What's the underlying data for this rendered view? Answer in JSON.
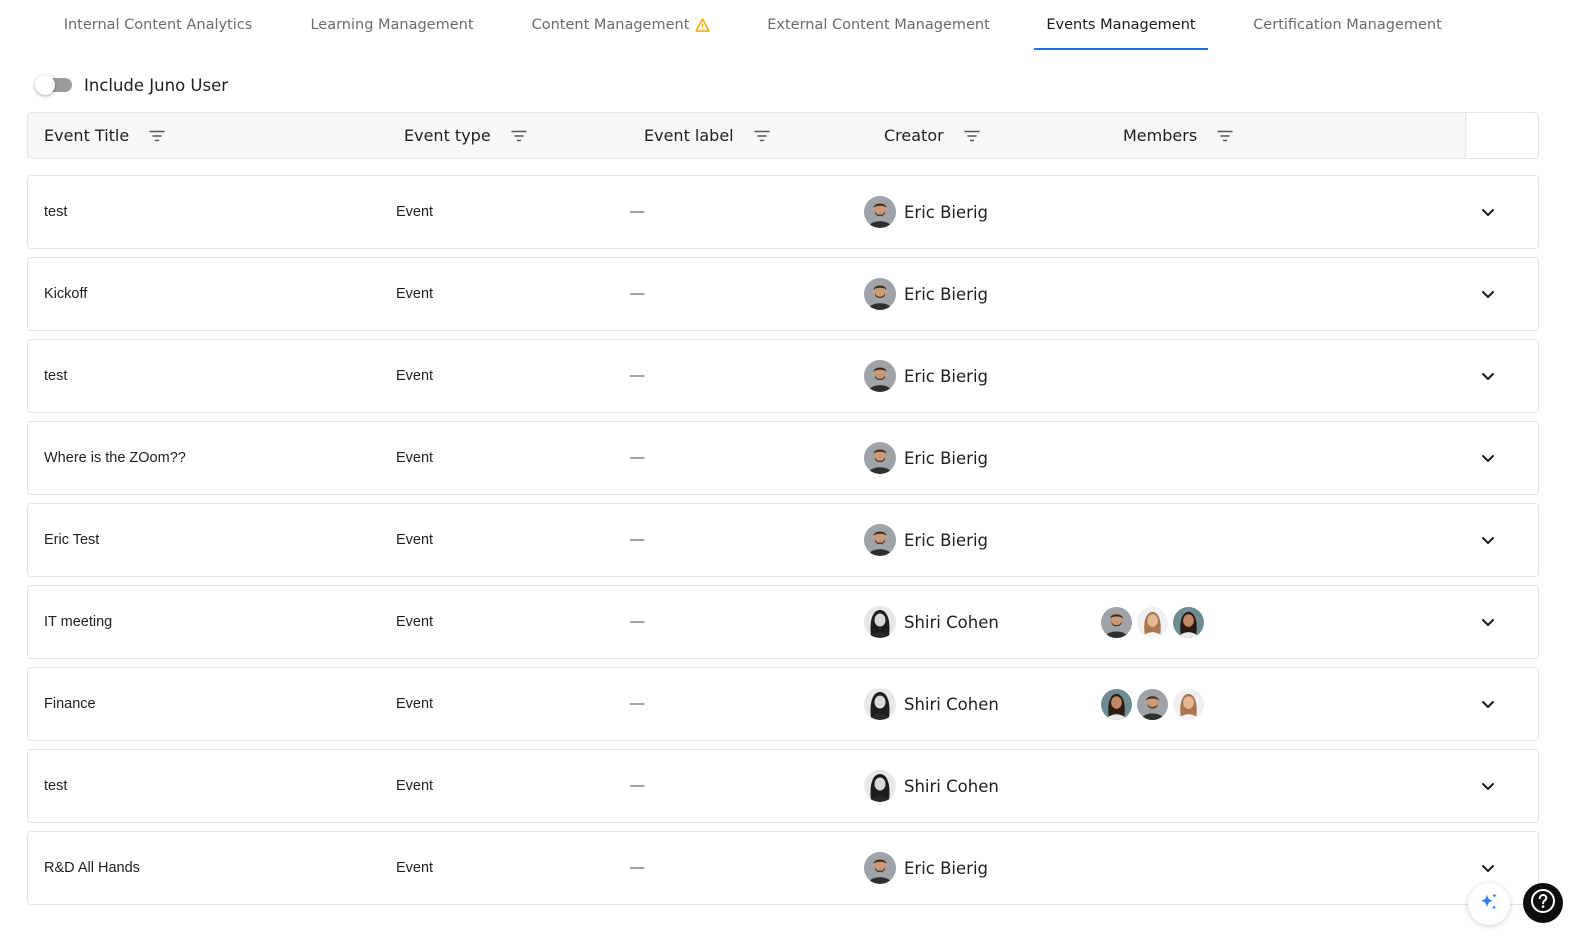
{
  "tabs": [
    {
      "label": "Internal Content Analytics"
    },
    {
      "label": "Learning Management"
    },
    {
      "label": "Content Management"
    },
    {
      "label": "External Content Management"
    },
    {
      "label": "Events Management"
    },
    {
      "label": "Certification Management"
    }
  ],
  "active_tab": "Events Management",
  "toggle": {
    "label": "Include Juno User",
    "checked": false
  },
  "columns": [
    {
      "label": "Event Title"
    },
    {
      "label": "Event type"
    },
    {
      "label": "Event label"
    },
    {
      "label": "Creator"
    },
    {
      "label": "Members"
    }
  ],
  "rows": [
    {
      "title": "test",
      "type": "Event",
      "label": "—",
      "creator": "Eric Bierig",
      "members": []
    },
    {
      "title": "Kickoff",
      "type": "Event",
      "label": "—",
      "creator": "Eric Bierig",
      "members": []
    },
    {
      "title": "test",
      "type": "Event",
      "label": "—",
      "creator": "Eric Bierig",
      "members": []
    },
    {
      "title": "Where is the ZOom??",
      "type": "Event",
      "label": "—",
      "creator": "Eric Bierig",
      "members": []
    },
    {
      "title": "Eric Test",
      "type": "Event",
      "label": "—",
      "creator": "Eric Bierig",
      "members": []
    },
    {
      "title": "IT meeting",
      "type": "Event",
      "label": "—",
      "creator": "Shiri Cohen",
      "members": [
        "man-avatar",
        "woman-light-avatar",
        "woman-dark-avatar"
      ]
    },
    {
      "title": "Finance",
      "type": "Event",
      "label": "—",
      "creator": "Shiri Cohen",
      "members": [
        "woman-dark-avatar",
        "man-avatar",
        "woman-light-avatar"
      ]
    },
    {
      "title": "test",
      "type": "Event",
      "label": "—",
      "creator": "Shiri Cohen",
      "members": []
    },
    {
      "title": "R&D All Hands",
      "type": "Event",
      "label": "—",
      "creator": "Eric Bierig",
      "members": []
    }
  ],
  "icons": {
    "filter": "filter-lines-icon",
    "expand": "chevron-down-icon",
    "warning": "warning-triangle-icon",
    "ai": "sparkle-icon",
    "help": "help-circle-icon"
  },
  "colors": {
    "accent": "#2b6fd6",
    "warning": "#f0a800",
    "ai": "#2f7be5"
  }
}
